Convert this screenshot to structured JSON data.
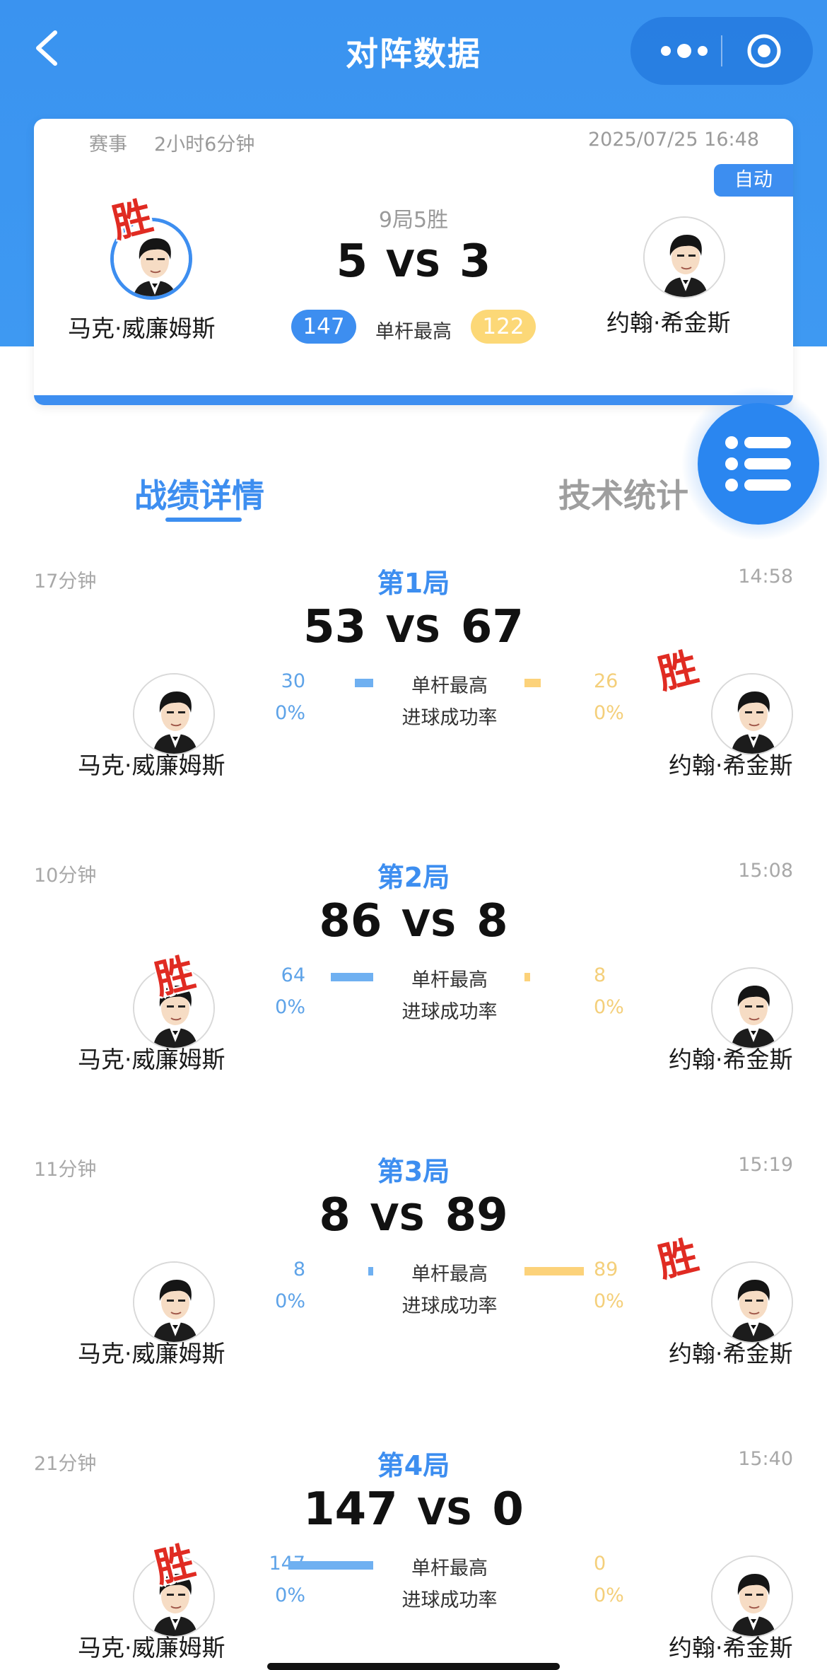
{
  "nav": {
    "title": "对阵数据"
  },
  "match": {
    "type_label": "赛事",
    "duration": "2小时6分钟",
    "datetime": "2025/07/25 16:48",
    "mode": "自动",
    "format": "9局5胜",
    "score_left": "5",
    "vs": "VS",
    "score_right": "3",
    "highbreak_left": "147",
    "highbreak_label": "单杆最高",
    "highbreak_right": "122",
    "player_left": "马克·威廉姆斯",
    "player_right": "约翰·希金斯",
    "winner": "left"
  },
  "win_label": "胜",
  "tabs": {
    "active": "战绩详情",
    "inactive": "技术统计"
  },
  "frames": [
    {
      "duration": "17分钟",
      "title": "第1局",
      "time": "14:58",
      "score_left": "53",
      "score_right": "67",
      "hb_left": "30",
      "hb_right": "26",
      "hb_left_frac": 0.22,
      "hb_right_frac": 0.19,
      "pct_left": "0%",
      "pct_right": "0%",
      "winner": "right"
    },
    {
      "duration": "10分钟",
      "title": "第2局",
      "time": "15:08",
      "score_left": "86",
      "score_right": "8",
      "hb_left": "64",
      "hb_right": "8",
      "hb_left_frac": 0.5,
      "hb_right_frac": 0.06,
      "pct_left": "0%",
      "pct_right": "0%",
      "winner": "left"
    },
    {
      "duration": "11分钟",
      "title": "第3局",
      "time": "15:19",
      "score_left": "8",
      "score_right": "89",
      "hb_left": "8",
      "hb_right": "89",
      "hb_left_frac": 0.06,
      "hb_right_frac": 0.7,
      "pct_left": "0%",
      "pct_right": "0%",
      "winner": "right"
    },
    {
      "duration": "21分钟",
      "title": "第4局",
      "time": "15:40",
      "score_left": "147",
      "score_right": "0",
      "hb_left": "147",
      "hb_right": "0",
      "hb_left_frac": 1.0,
      "hb_right_frac": 0.0,
      "pct_left": "0%",
      "pct_right": "0%",
      "winner": "left"
    }
  ],
  "labels": {
    "highbreak": "单杆最高",
    "success_rate": "进球成功率",
    "vs": "VS"
  },
  "colors": {
    "primary": "#3d8ef0",
    "left_bar": "#6fb0f1",
    "right_bar": "#fcd27a",
    "win": "#e02b22"
  }
}
